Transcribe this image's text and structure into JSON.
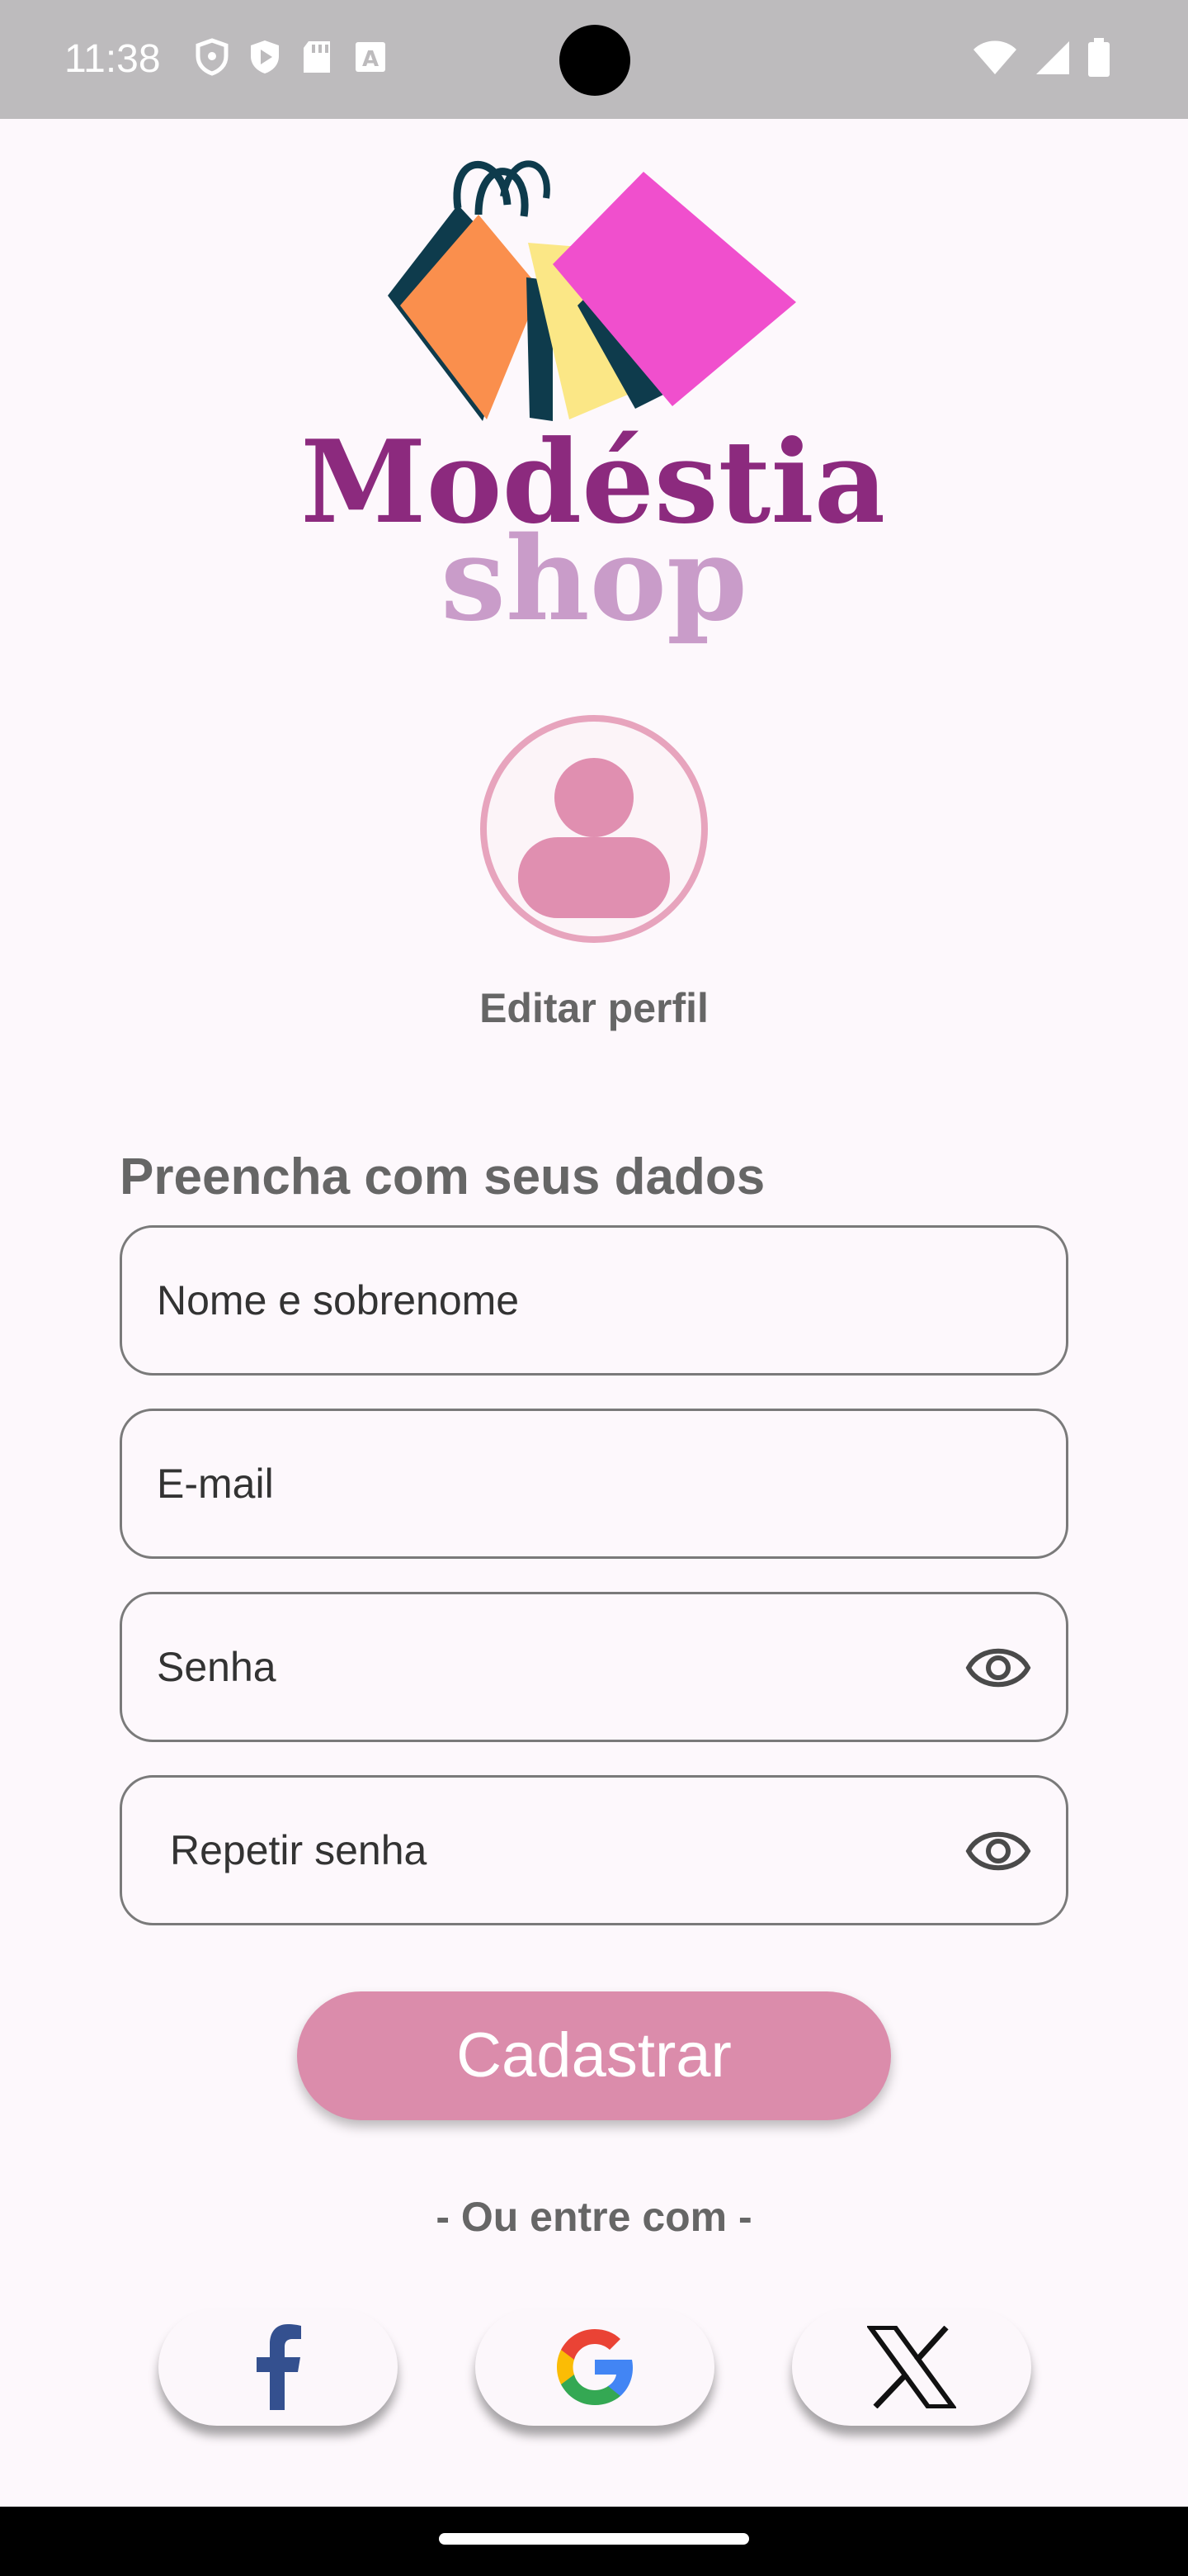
{
  "status_bar": {
    "time": "11:38",
    "icons_left": [
      "vpn-shield-icon",
      "play-protect-icon",
      "sd-card-icon",
      "font-icon"
    ],
    "icons_right": [
      "wifi-icon",
      "signal-icon",
      "battery-icon"
    ]
  },
  "logo": {
    "brand_name": "Modéstia",
    "brand_sub": "shop",
    "colors": {
      "brand_purple": "#8c2a7e",
      "brand_lilac": "#c99cc9"
    }
  },
  "profile": {
    "edit_label": "Editar perfil",
    "avatar_icon": "user-avatar-icon"
  },
  "form": {
    "title": "Preencha com seus dados",
    "fields": [
      {
        "placeholder": "Nome e sobrenome"
      },
      {
        "placeholder": "E-mail"
      },
      {
        "placeholder": "Senha",
        "icon": "eye-icon"
      },
      {
        "placeholder": "Repetir senha",
        "icon": "eye-icon"
      }
    ],
    "submit_label": "Cadastrar"
  },
  "social": {
    "label": "- Ou entre com -",
    "providers": [
      "Facebook",
      "Google",
      "X"
    ]
  },
  "colors": {
    "accent": "#db8cab",
    "background": "#fdf8fc",
    "status_bar": "#bdbbbd"
  }
}
